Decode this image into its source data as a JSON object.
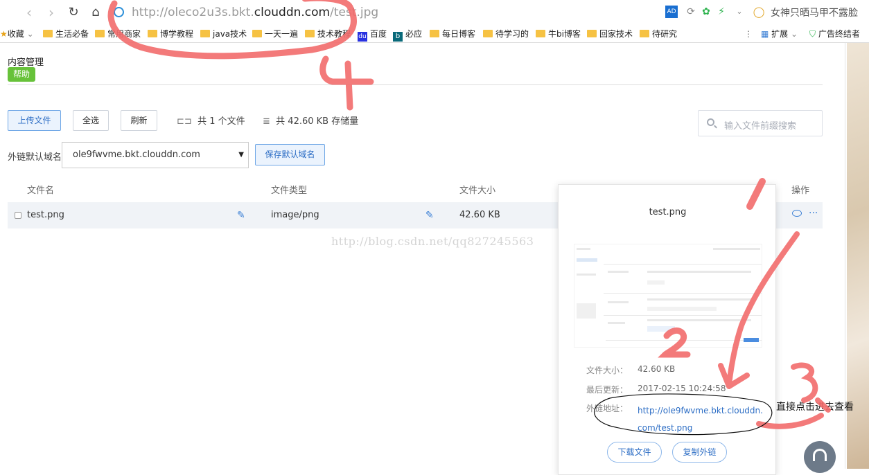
{
  "browser": {
    "address_dim": "http://oleco2u3s.bkt.",
    "address_host": "clouddn.com",
    "address_path": "/test.jpg",
    "right_text": "女神只晒马甲不露脸"
  },
  "bookmarks": [
    {
      "label": "收藏",
      "icon": "star-icon"
    },
    {
      "label": "生活必备",
      "icon": "folder-icon"
    },
    {
      "label": "常用商家",
      "icon": "folder-icon"
    },
    {
      "label": "博学教程",
      "icon": "folder-icon"
    },
    {
      "label": "java技术",
      "icon": "folder-icon"
    },
    {
      "label": "一天一遍",
      "icon": "folder-icon"
    },
    {
      "label": "技术教程",
      "icon": "folder-icon"
    },
    {
      "label": "百度",
      "icon": "baidu-icon"
    },
    {
      "label": "必应",
      "icon": "bing-icon"
    },
    {
      "label": "每日博客",
      "icon": "folder-icon"
    },
    {
      "label": "待学习的",
      "icon": "folder-icon"
    },
    {
      "label": "牛bi博客",
      "icon": "folder-icon"
    },
    {
      "label": "回家技术",
      "icon": "folder-icon"
    },
    {
      "label": "待研究",
      "icon": "folder-icon"
    },
    {
      "label": "扩展",
      "icon": "extensions-icon"
    },
    {
      "label": "广告终结者",
      "icon": "shield-icon"
    }
  ],
  "page": {
    "title": "内容管理",
    "help": "帮助",
    "toolbar": {
      "upload": "上传文件",
      "select_all": "全选",
      "refresh": "刷新",
      "file_count": "共 1 个文件",
      "storage": "共 42.60 KB 存储量"
    },
    "search_placeholder": "输入文件前缀搜索",
    "domain_label": "外链默认域名",
    "domain_value": "ole9fwvme.bkt.clouddn.com",
    "save_domain": "保存默认域名",
    "table": {
      "headers": [
        "文件名",
        "文件类型",
        "文件大小",
        "操作"
      ],
      "rows": [
        {
          "name": "test.png",
          "type": "image/png",
          "size": "42.60 KB"
        }
      ]
    },
    "watermark": "http://blog.csdn.net/qq827245563"
  },
  "popup": {
    "title": "test.png",
    "size_label": "文件大小：",
    "size_value": "42.60 KB",
    "updated_label": "最后更新：",
    "updated_value": "2017-02-15 10:24:58",
    "url_label": "外链地址：",
    "url_value": "http://ole9fwvme.bkt.clouddn.com/test.png",
    "download": "下载文件",
    "copy_link": "复制外链"
  },
  "annotations": {
    "handwritten_note": "直接点击进去查看",
    "numbers": [
      "4",
      "1",
      "2",
      "3"
    ],
    "color": "#f26b6b"
  }
}
